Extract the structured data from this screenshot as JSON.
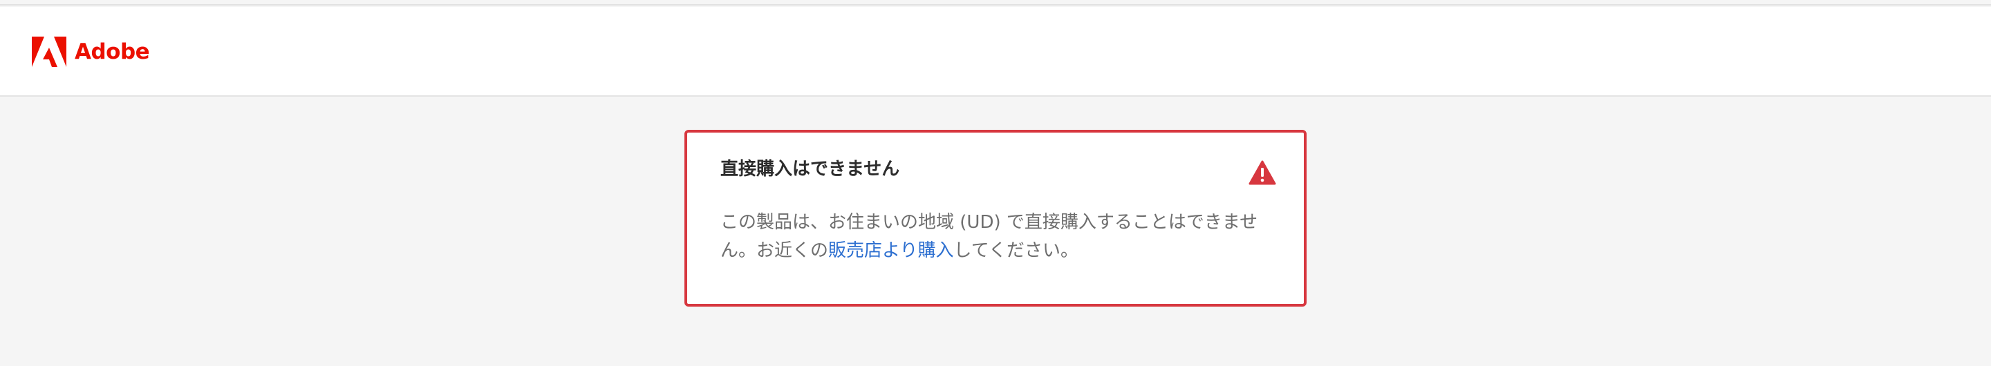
{
  "header": {
    "brand_name": "Adobe",
    "logo_icon": "adobe-logo-icon",
    "brand_color": "#eb1000"
  },
  "alert": {
    "title": "直接購入はできません",
    "icon": "warning-icon",
    "border_color": "#d7373f",
    "message_before_link": "この製品は、お住まいの地域 (UD) で直接購入することはできません。お近くの",
    "link_text": "販売店より購入",
    "message_after_link": "してください。",
    "link_color": "#2d6fd0"
  }
}
